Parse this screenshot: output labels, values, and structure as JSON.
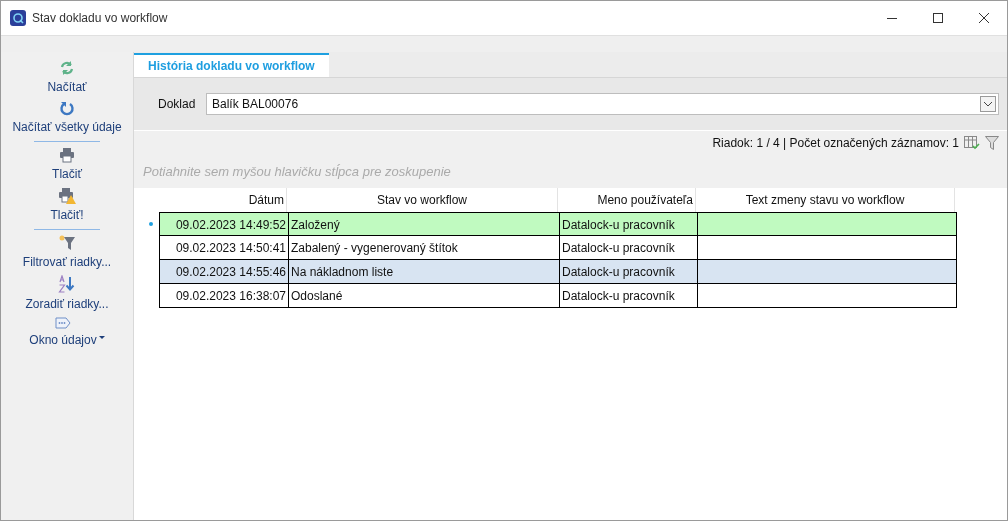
{
  "window": {
    "title": "Stav dokladu vo workflow"
  },
  "sidebar": {
    "items": [
      {
        "kind": "refresh",
        "label": "Načítať"
      },
      {
        "kind": "reload",
        "label": "Načítať všetky údaje"
      },
      {
        "kind": "separator"
      },
      {
        "kind": "print",
        "label": "Tlačiť"
      },
      {
        "kind": "print-warning",
        "label": "Tlačiť!"
      },
      {
        "kind": "separator"
      },
      {
        "kind": "filter",
        "label": "Filtrovať riadky..."
      },
      {
        "kind": "sort",
        "label": "Zoradiť riadky..."
      },
      {
        "kind": "data-window",
        "label": "Okno údajov",
        "has_menu": true
      }
    ]
  },
  "tabs": [
    {
      "label": "História dokladu vo workflow",
      "selected": true
    }
  ],
  "document_field": {
    "label": "Doklad",
    "value": "Balík BAL00076"
  },
  "status": {
    "text": "Riadok: 1 / 4 | Počet označených záznamov: 1"
  },
  "group_panel": {
    "placeholder": "Potiahnite sem myšou hlavičku stĺpca pre zoskupenie"
  },
  "table": {
    "columns": [
      {
        "label": "Dátum"
      },
      {
        "label": "Stav vo workflow"
      },
      {
        "label": "Meno používateľa"
      },
      {
        "label": "Text zmeny stavu vo workflow"
      }
    ],
    "rows": [
      {
        "cells": [
          "09.02.2023 14:49:52",
          "Založený",
          "Datalock-u pracovník"
        ],
        "current": true,
        "selected": false
      },
      {
        "cells": [
          "09.02.2023 14:50:41",
          "Zabalený - vygenerovaný štítok",
          "Datalock-u pracovník"
        ],
        "current": false,
        "selected": false
      },
      {
        "cells": [
          "09.02.2023 14:55:46",
          "Na nákladnom liste",
          "Datalock-u pracovník"
        ],
        "current": false,
        "selected": true
      },
      {
        "cells": [
          "09.02.2023 16:38:07",
          "Odoslané",
          "Datalock-u pracovník"
        ],
        "current": false,
        "selected": false
      }
    ]
  }
}
